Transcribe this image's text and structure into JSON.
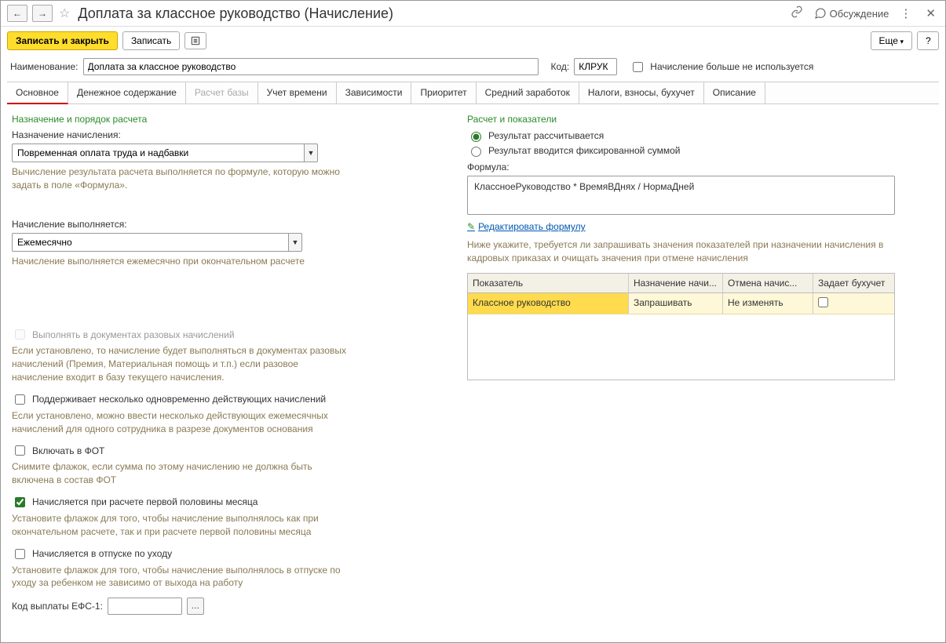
{
  "title": "Доплата за классное руководство (Начисление)",
  "titlebar": {
    "discuss": "Обсуждение"
  },
  "toolbar": {
    "save_close": "Записать и закрыть",
    "save": "Записать",
    "more": "Еще",
    "help": "?"
  },
  "fields": {
    "name_label": "Наименование:",
    "name_value": "Доплата за классное руководство",
    "code_label": "Код:",
    "code_value": "КЛРУК",
    "not_used_label": "Начисление больше не используется"
  },
  "tabs": {
    "main": "Основное",
    "money": "Денежное содержание",
    "base": "Расчет базы",
    "time": "Учет времени",
    "deps": "Зависимости",
    "priority": "Приоритет",
    "avg": "Средний заработок",
    "tax": "Налоги, взносы, бухучет",
    "desc": "Описание"
  },
  "left": {
    "section1": "Назначение и порядок расчета",
    "purpose_label": "Назначение начисления:",
    "purpose_value": "Повременная оплата труда и надбавки",
    "purpose_hint": "Вычисление результата расчета выполняется по формуле, которую можно задать в поле «Формула».",
    "perform_label": "Начисление выполняется:",
    "perform_value": "Ежемесячно",
    "perform_hint": "Начисление выполняется ежемесячно при окончательном расчете",
    "chk_once": "Выполнять в документах разовых начислений",
    "chk_once_hint": "Если установлено, то начисление будет выполняться в документах разовых начислений (Премия, Материальная помощь и т.п.) если разовое начисление входит в базу текущего начисления.",
    "chk_multi": "Поддерживает несколько одновременно действующих начислений",
    "chk_multi_hint": "Если установлено, можно ввести несколько действующих ежемесячных начислений для одного сотрудника в разрезе документов основания",
    "chk_fot": "Включать в ФОТ",
    "chk_fot_hint": "Снимите флажок, если сумма по этому начислению не должна быть включена в состав ФОТ",
    "chk_half": "Начисляется при расчете первой половины месяца",
    "chk_half_hint": "Установите флажок для того, чтобы начисление выполнялось как при окончательном расчете, так и при расчете первой половины месяца",
    "chk_leave": "Начисляется в отпуске по уходу",
    "chk_leave_hint": "Установите флажок для того, чтобы начисление выполнялось в отпуске по уходу за ребенком не зависимо от выхода на работу",
    "efs_label": "Код выплаты ЕФС-1:"
  },
  "right": {
    "section": "Расчет и показатели",
    "radio_calc": "Результат рассчитывается",
    "radio_fixed": "Результат вводится фиксированной суммой",
    "formula_label": "Формула:",
    "formula_value": "КлассноеРуководство * ВремяВДнях / НормаДней",
    "edit_formula": "Редактировать формулу",
    "table_hint": "Ниже укажите, требуется ли запрашивать значения показателей при назначении начисления в кадровых приказах и очищать значения при отмене начисления",
    "th1": "Показатель",
    "th2": "Назначение начи...",
    "th3": "Отмена начис...",
    "th4": "Задает бухучет",
    "row1": {
      "indicator": "Классное руководство",
      "assign": "Запрашивать",
      "cancel": "Не изменять"
    }
  }
}
